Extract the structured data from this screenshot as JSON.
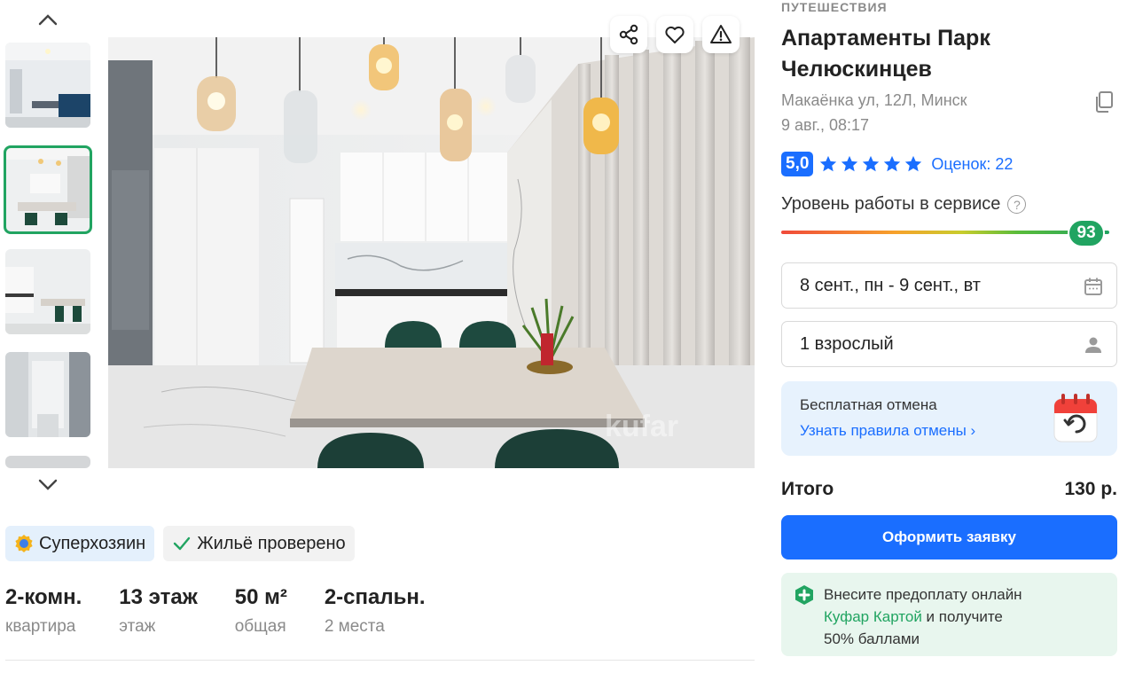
{
  "gallery": {
    "thumbnails": [
      {
        "scene": "corridor-dark"
      },
      {
        "scene": "kitchen-table",
        "active": true
      },
      {
        "scene": "kitchen-wide"
      },
      {
        "scene": "hallway"
      },
      {
        "scene": "partial"
      }
    ]
  },
  "badges": {
    "superhost": "Суперхозяин",
    "verified": "Жильё проверено"
  },
  "specs": [
    {
      "value": "2-комн.",
      "label": "квартира"
    },
    {
      "value": "13 этаж",
      "label": "этаж"
    },
    {
      "value": "50 м²",
      "label": "общая"
    },
    {
      "value": "2-спальн.",
      "label": "2 места"
    }
  ],
  "listing": {
    "category": "ПУТЕШЕСТВИЯ",
    "title": "Апартаменты Парк Челюскинцев",
    "address": "Макаёнка ул, 12Л, Минск",
    "date": "9 авг., 08:17"
  },
  "rating": {
    "score": "5,0",
    "stars": 5,
    "reviews_label": "Оценок: 22"
  },
  "service": {
    "label": "Уровень работы в сервисе",
    "help": "?",
    "score": "93",
    "score_fraction": 0.93
  },
  "booking": {
    "dates": "8 сент., пн - 9 сент., вт",
    "guests": "1 взрослый"
  },
  "cancellation": {
    "title": "Бесплатная отмена",
    "link": "Узнать правила отмены ›"
  },
  "total": {
    "label": "Итого",
    "price": "130 р."
  },
  "submit_label": "Оформить заявку",
  "promo": {
    "line1": "Внесите предоплату онлайн",
    "link": "Куфар Картой",
    "line2_rest": " и получите",
    "line3": "50% баллами"
  },
  "watermark": "kufar",
  "colors": {
    "accent_blue": "#1a6eff",
    "accent_green": "#21a461",
    "star_blue": "#1a6eff"
  }
}
